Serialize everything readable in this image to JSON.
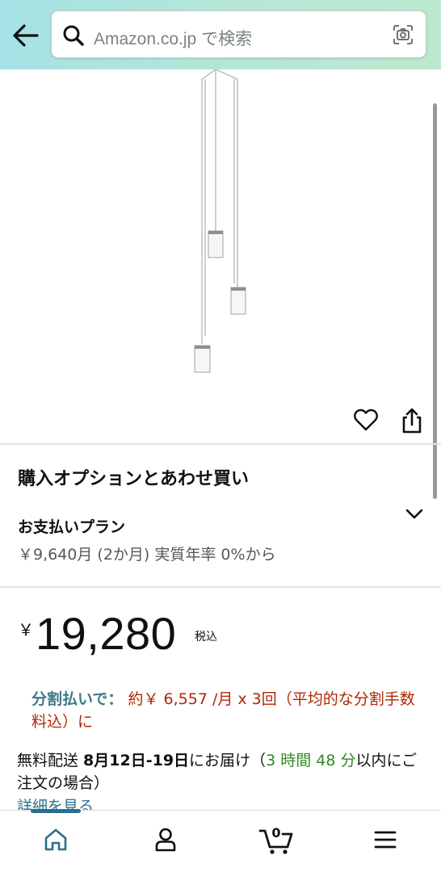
{
  "header": {
    "search_placeholder": "Amazon.co.jp で検索"
  },
  "icons": {
    "back": "arrow-left-icon",
    "search": "search-icon",
    "camera": "camera-scan-icon",
    "favorite": "heart-icon",
    "share": "share-icon",
    "chevron": "chevron-down-icon",
    "home": "home-icon",
    "account": "person-icon",
    "cart": "cart-icon",
    "menu": "hamburger-menu-icon"
  },
  "colors": {
    "header_gradient_start": "#a6e1e6",
    "header_gradient_end": "#bde8d0",
    "installment_label": "#3d7a87",
    "installment_text": "#b12704",
    "delivery_highlight": "#2f8a1f",
    "link": "#2a6f8f"
  },
  "purchase_options": {
    "title": "購入オプションとあわせ買い",
    "payment_plan_label": "お支払いプラン",
    "payment_plan_detail": "￥9,640月 (2か月) 実質年率 0%から"
  },
  "price": {
    "currency": "￥",
    "value": "19,280",
    "tax_note": "税込"
  },
  "installment": {
    "label": "分割払いで：",
    "text": " 約￥ 6,557 /月 x 3回（平均的な分割手数料込）に"
  },
  "delivery": {
    "prefix": "無料配送  ",
    "date": "8月12日-19日",
    "middle": "にお届け（",
    "countdown": "3 時間 48 分",
    "suffix": "以内にご注文の場合）",
    "details_link": "詳細を見る"
  },
  "bottom_nav": {
    "cart_count": "0"
  }
}
